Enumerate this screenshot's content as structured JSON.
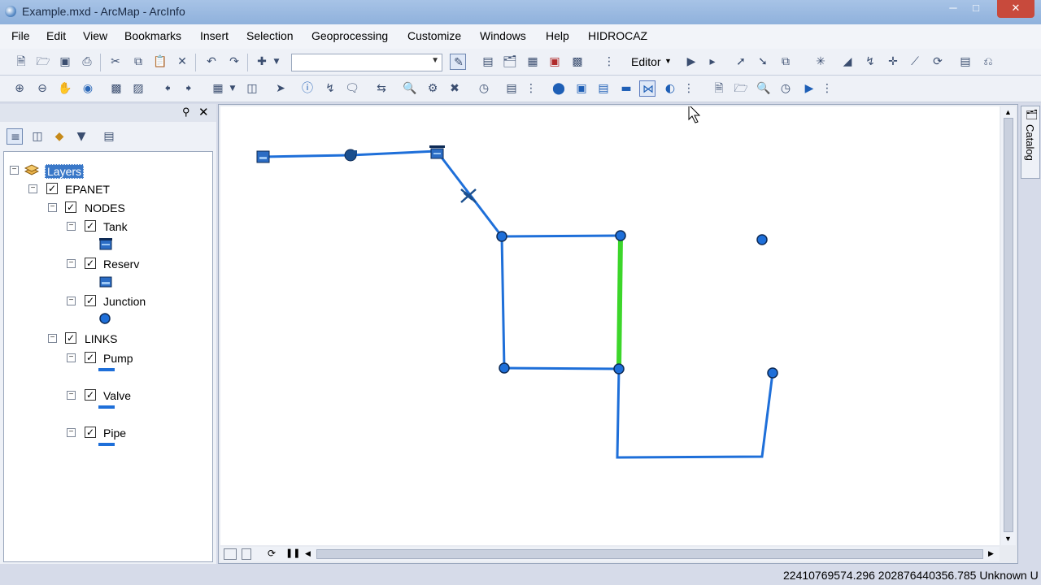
{
  "window": {
    "title": "Example.mxd - ArcMap - ArcInfo"
  },
  "menu": [
    "File",
    "Edit",
    "View",
    "Bookmarks",
    "Insert",
    "Selection",
    "Geoprocessing",
    "Customize",
    "Windows",
    "Help",
    "HIDROCAZ"
  ],
  "toolbar": {
    "editor_label": "Editor",
    "scale_value": ""
  },
  "toc": {
    "layers": [
      {
        "label": "Layers",
        "level": 0,
        "checkbox": false,
        "checked": false,
        "selected": true,
        "symbol": "layers-icon"
      },
      {
        "label": "EPANET",
        "level": 1,
        "checkbox": true,
        "checked": true,
        "selected": false,
        "symbol": ""
      },
      {
        "label": "NODES",
        "level": 2,
        "checkbox": true,
        "checked": true,
        "selected": false,
        "symbol": ""
      },
      {
        "label": "Tank",
        "level": 3,
        "checkbox": true,
        "checked": true,
        "selected": false,
        "symbol": "tank-symbol-icon"
      },
      {
        "label": "Reserv",
        "level": 3,
        "checkbox": true,
        "checked": true,
        "selected": false,
        "symbol": "reservoir-symbol-icon"
      },
      {
        "label": "Junction",
        "level": 3,
        "checkbox": true,
        "checked": true,
        "selected": false,
        "symbol": "junction-symbol-icon"
      },
      {
        "label": "LINKS",
        "level": 2,
        "checkbox": true,
        "checked": true,
        "selected": false,
        "symbol": ""
      },
      {
        "label": "Pump",
        "level": 3,
        "checkbox": true,
        "checked": true,
        "selected": false,
        "symbol": "line-symbol-icon"
      },
      {
        "label": "Valve",
        "level": 3,
        "checkbox": true,
        "checked": true,
        "selected": false,
        "symbol": "line-symbol-icon"
      },
      {
        "label": "Pipe",
        "level": 3,
        "checkbox": true,
        "checked": true,
        "selected": false,
        "symbol": "line-symbol-icon"
      }
    ]
  },
  "catalog_tab": {
    "label": "Catalog"
  },
  "status": {
    "coordinates": "22410769574.296  202876440356.785 Unknown U"
  },
  "colors": {
    "pipe": "#1e6fd9",
    "selected_pipe": "#3cd62a",
    "junction": "#1e6fd9",
    "selection": "#3a78c8"
  }
}
